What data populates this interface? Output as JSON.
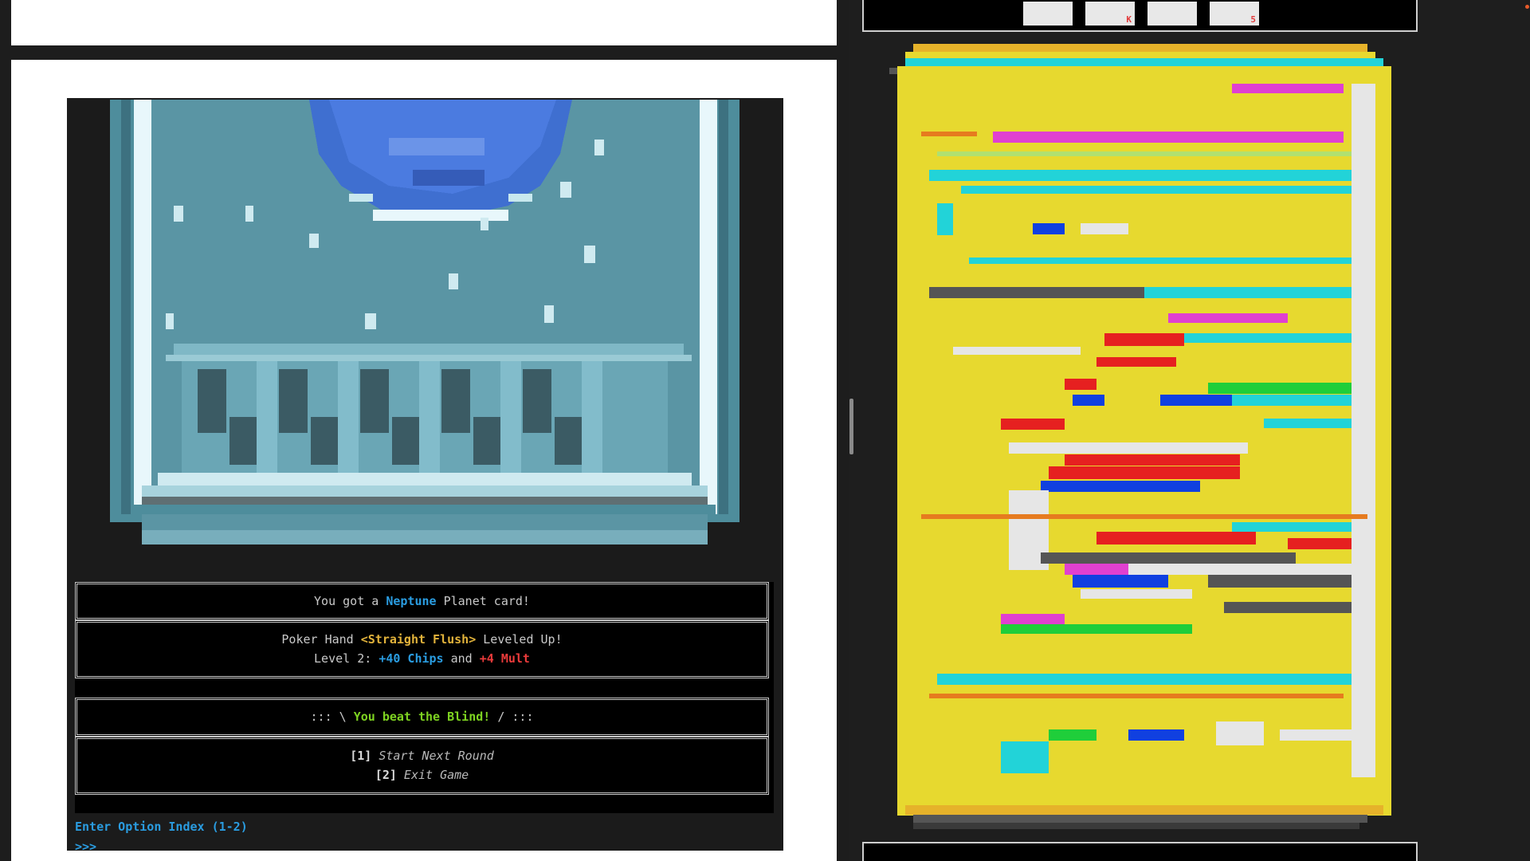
{
  "messages": {
    "planet": {
      "prefix": "You got a ",
      "planet_name": "Neptune",
      "suffix": " Planet card!"
    },
    "level_up": {
      "line1_prefix": "Poker Hand ",
      "hand_name": "<Straight Flush>",
      "line1_suffix": " Leveled Up!",
      "line2_prefix": "Level 2: ",
      "chips": "+40 Chips",
      "and": " and ",
      "mult": "+4 Mult"
    },
    "blind": {
      "left": "::: \\ ",
      "text": "You beat the Blind!",
      "right": " / :::"
    },
    "options": [
      {
        "index": "[1]",
        "label": "Start Next Round"
      },
      {
        "index": "[2]",
        "label": "Exit Game"
      }
    ]
  },
  "prompt": {
    "label": "Enter Option Index (1-2)",
    "cursor": ">>>"
  },
  "right_panel": {
    "tabs": [
      {
        "label": ""
      },
      {
        "label": "K"
      },
      {
        "label": ""
      },
      {
        "label": "5"
      }
    ]
  },
  "colors": {
    "neptune_blue": "#2a9ce0",
    "hand_yellow": "#e2b33b",
    "mult_red": "#ec3b3b",
    "blind_green": "#7ed321",
    "card_teal": "#5a95a4",
    "board_yellow": "#e7d92f"
  }
}
